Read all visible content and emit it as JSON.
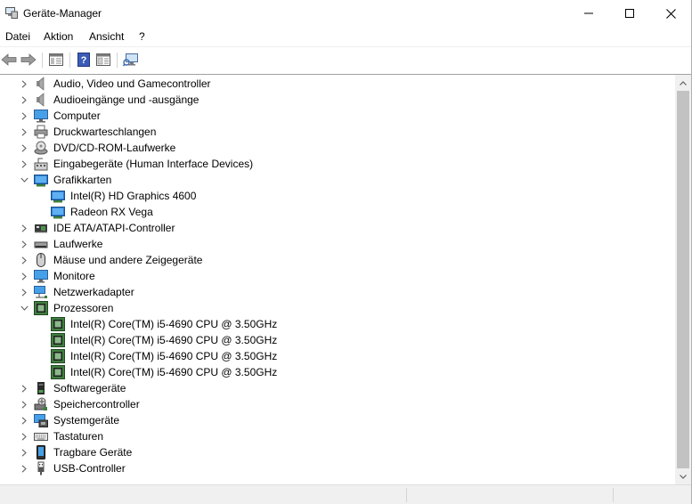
{
  "window": {
    "title": "Geräte-Manager",
    "icons": {
      "app": "device-manager-icon",
      "minimize": "minimize-icon",
      "maximize": "maximize-icon",
      "close": "close-icon"
    }
  },
  "menu": {
    "items": [
      "Datei",
      "Aktion",
      "Ansicht",
      "?"
    ]
  },
  "toolbar": {
    "buttons": [
      "back-arrow-icon",
      "forward-arrow-icon",
      "show-hide-console-tree-icon",
      "help-icon",
      "properties-icon",
      "scan-hardware-icon"
    ]
  },
  "tree": {
    "rows": [
      {
        "label": "Audio, Video und Gamecontroller",
        "icon": "speaker-icon",
        "expanded": false
      },
      {
        "label": "Audioeingänge und -ausgänge",
        "icon": "speaker-icon",
        "expanded": false
      },
      {
        "label": "Computer",
        "icon": "computer-icon",
        "expanded": false
      },
      {
        "label": "Druckwarteschlangen",
        "icon": "printer-icon",
        "expanded": false
      },
      {
        "label": "DVD/CD-ROM-Laufwerke",
        "icon": "dvd-drive-icon",
        "expanded": false
      },
      {
        "label": "Eingabegeräte (Human Interface Devices)",
        "icon": "hid-icon",
        "expanded": false
      },
      {
        "label": "Grafikkarten",
        "icon": "display-adapter-icon",
        "expanded": true
      },
      {
        "label": "Intel(R) HD Graphics 4600",
        "icon": "display-adapter-icon",
        "child": true
      },
      {
        "label": "Radeon RX Vega",
        "icon": "display-adapter-icon",
        "child": true
      },
      {
        "label": "IDE ATA/ATAPI-Controller",
        "icon": "ide-controller-icon",
        "expanded": false
      },
      {
        "label": "Laufwerke",
        "icon": "disk-drive-icon",
        "expanded": false
      },
      {
        "label": "Mäuse und andere Zeigegeräte",
        "icon": "mouse-icon",
        "expanded": false
      },
      {
        "label": "Monitore",
        "icon": "monitor-icon",
        "expanded": false
      },
      {
        "label": "Netzwerkadapter",
        "icon": "network-adapter-icon",
        "expanded": false
      },
      {
        "label": "Prozessoren",
        "icon": "processor-icon",
        "expanded": true
      },
      {
        "label": "Intel(R) Core(TM) i5-4690 CPU @ 3.50GHz",
        "icon": "processor-icon",
        "child": true
      },
      {
        "label": "Intel(R) Core(TM) i5-4690 CPU @ 3.50GHz",
        "icon": "processor-icon",
        "child": true
      },
      {
        "label": "Intel(R) Core(TM) i5-4690 CPU @ 3.50GHz",
        "icon": "processor-icon",
        "child": true
      },
      {
        "label": "Intel(R) Core(TM) i5-4690 CPU @ 3.50GHz",
        "icon": "processor-icon",
        "child": true
      },
      {
        "label": "Softwaregeräte",
        "icon": "software-device-icon",
        "expanded": false
      },
      {
        "label": "Speichercontroller",
        "icon": "storage-controller-icon",
        "expanded": false
      },
      {
        "label": "Systemgeräte",
        "icon": "system-device-icon",
        "expanded": false
      },
      {
        "label": "Tastaturen",
        "icon": "keyboard-icon",
        "expanded": false
      },
      {
        "label": "Tragbare Geräte",
        "icon": "portable-device-icon",
        "expanded": false
      },
      {
        "label": "USB-Controller",
        "icon": "usb-icon",
        "expanded": false
      }
    ]
  },
  "colors": {
    "accent_blue": "#2f7fd6",
    "processor_green": "#3f7f3f"
  }
}
